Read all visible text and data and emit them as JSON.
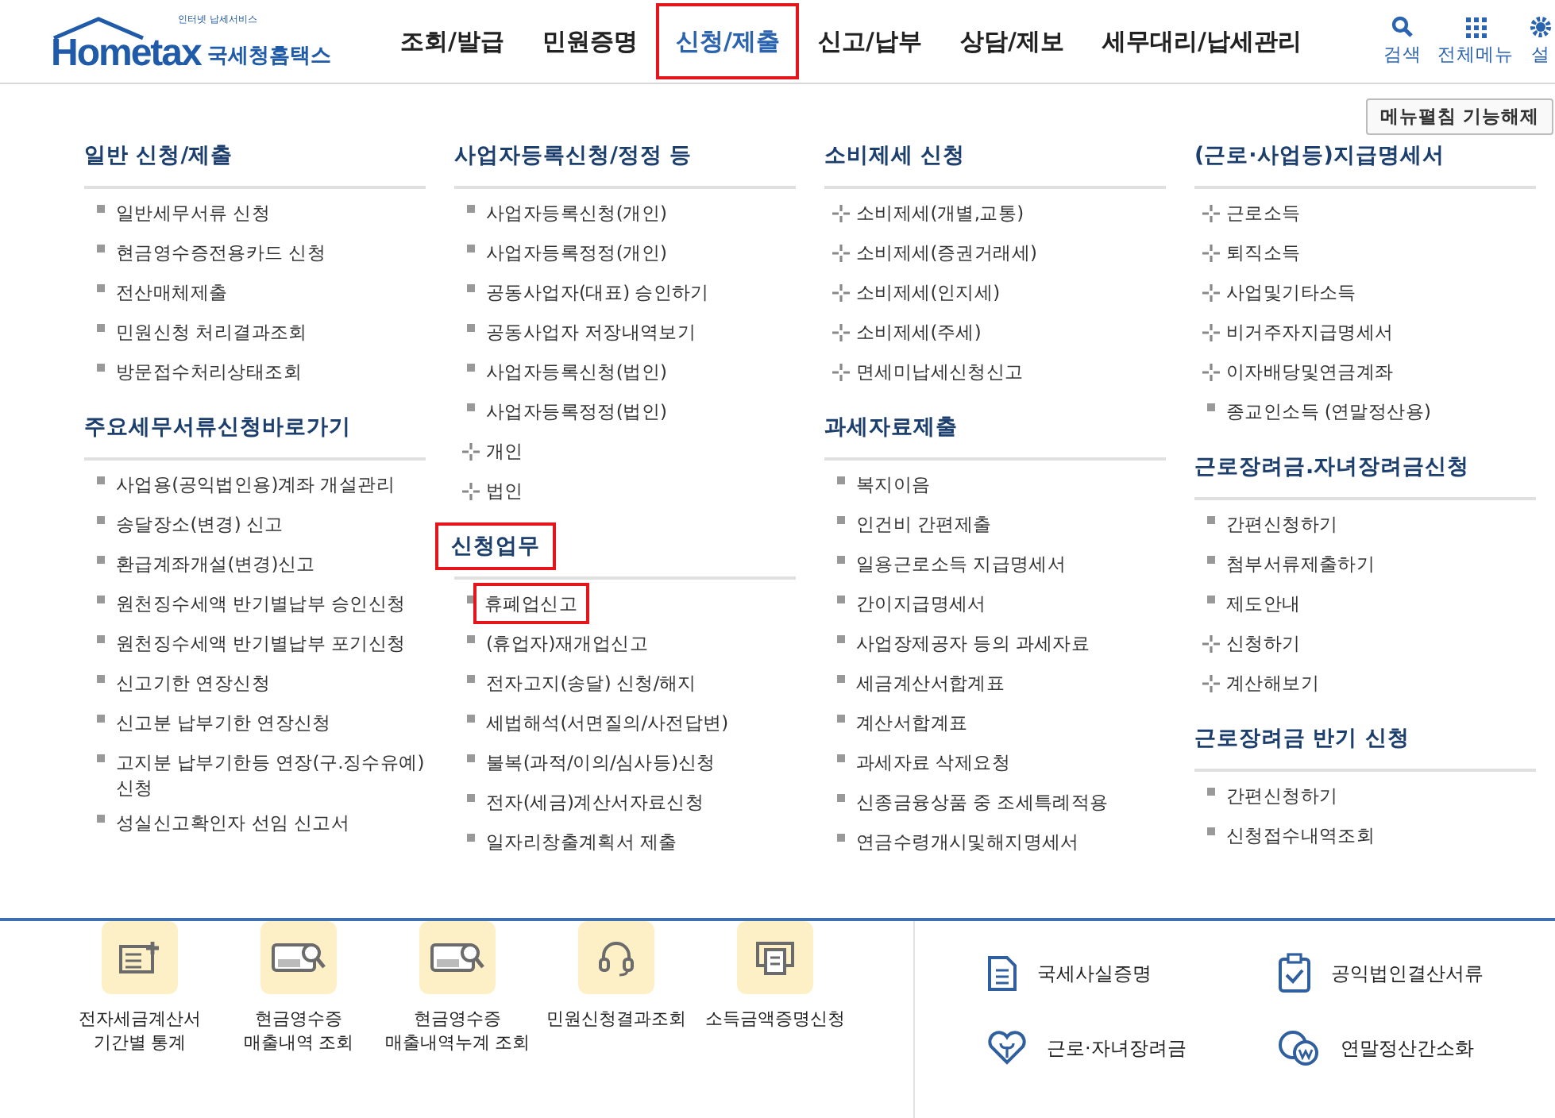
{
  "logo": {
    "tagline": "인터넷 납세서비스",
    "brand": "Hometax",
    "name": "국세청홈택스"
  },
  "nav": [
    {
      "label": "조회/발급",
      "selected": false,
      "highlighted": false
    },
    {
      "label": "민원증명",
      "selected": false,
      "highlighted": false
    },
    {
      "label": "신청/제출",
      "selected": true,
      "highlighted": true
    },
    {
      "label": "신고/납부",
      "selected": false,
      "highlighted": false
    },
    {
      "label": "상담/제보",
      "selected": false,
      "highlighted": false
    },
    {
      "label": "세무대리/납세관리",
      "selected": false,
      "highlighted": false
    }
  ],
  "utility": [
    {
      "kind": "search",
      "label": "검색"
    },
    {
      "kind": "grid",
      "label": "전체메뉴"
    },
    {
      "kind": "gear",
      "label": "설"
    }
  ],
  "menu_toggle_button": "메뉴펼침 기능해제",
  "columns": [
    [
      {
        "title": "일반 신청/제출",
        "highlighted": false,
        "items": [
          {
            "label": "일반세무서류 신청",
            "kind": "square",
            "highlighted": false
          },
          {
            "label": "현금영수증전용카드 신청",
            "kind": "square",
            "highlighted": false
          },
          {
            "label": "전산매체제출",
            "kind": "square",
            "highlighted": false
          },
          {
            "label": "민원신청 처리결과조회",
            "kind": "square",
            "highlighted": false
          },
          {
            "label": "방문접수처리상태조회",
            "kind": "square",
            "highlighted": false
          }
        ]
      },
      {
        "title": "주요세무서류신청바로가기",
        "highlighted": false,
        "items": [
          {
            "label": "사업용(공익법인용)계좌 개설관리",
            "kind": "square",
            "highlighted": false
          },
          {
            "label": "송달장소(변경) 신고",
            "kind": "square",
            "highlighted": false
          },
          {
            "label": "환급계좌개설(변경)신고",
            "kind": "square",
            "highlighted": false
          },
          {
            "label": "원천징수세액 반기별납부 승인신청",
            "kind": "square",
            "highlighted": false
          },
          {
            "label": "원천징수세액 반기별납부 포기신청",
            "kind": "square",
            "highlighted": false
          },
          {
            "label": "신고기한 연장신청",
            "kind": "square",
            "highlighted": false
          },
          {
            "label": "신고분 납부기한 연장신청",
            "kind": "square",
            "highlighted": false
          },
          {
            "label": "고지분 납부기한등 연장(구.징수유예) 신청",
            "kind": "square",
            "highlighted": false
          },
          {
            "label": "성실신고확인자 선임 신고서",
            "kind": "square",
            "highlighted": false
          }
        ]
      }
    ],
    [
      {
        "title": "사업자등록신청/정정 등",
        "highlighted": false,
        "items": [
          {
            "label": "사업자등록신청(개인)",
            "kind": "square",
            "highlighted": false
          },
          {
            "label": "사업자등록정정(개인)",
            "kind": "square",
            "highlighted": false
          },
          {
            "label": "공동사업자(대표) 승인하기",
            "kind": "square",
            "highlighted": false
          },
          {
            "label": "공동사업자 저장내역보기",
            "kind": "square",
            "highlighted": false
          },
          {
            "label": "사업자등록신청(법인)",
            "kind": "square",
            "highlighted": false
          },
          {
            "label": "사업자등록정정(법인)",
            "kind": "square",
            "highlighted": false
          },
          {
            "label": "개인",
            "kind": "plus",
            "highlighted": false
          },
          {
            "label": "법인",
            "kind": "plus",
            "highlighted": false
          }
        ]
      },
      {
        "title": "신청업무",
        "highlighted": true,
        "items": [
          {
            "label": "휴폐업신고",
            "kind": "square",
            "highlighted": true
          },
          {
            "label": "(휴업자)재개업신고",
            "kind": "square",
            "highlighted": false
          },
          {
            "label": "전자고지(송달) 신청/해지",
            "kind": "square",
            "highlighted": false
          },
          {
            "label": "세법해석(서면질의/사전답변)",
            "kind": "square",
            "highlighted": false
          },
          {
            "label": "불복(과적/이의/심사등)신청",
            "kind": "square",
            "highlighted": false
          },
          {
            "label": "전자(세금)계산서자료신청",
            "kind": "square",
            "highlighted": false
          },
          {
            "label": "일자리창출계획서 제출",
            "kind": "square",
            "highlighted": false
          }
        ]
      }
    ],
    [
      {
        "title": "소비제세 신청",
        "highlighted": false,
        "items": [
          {
            "label": "소비제세(개별,교통)",
            "kind": "plus",
            "highlighted": false
          },
          {
            "label": "소비제세(증권거래세)",
            "kind": "plus",
            "highlighted": false
          },
          {
            "label": "소비제세(인지세)",
            "kind": "plus",
            "highlighted": false
          },
          {
            "label": "소비제세(주세)",
            "kind": "plus",
            "highlighted": false
          },
          {
            "label": "면세미납세신청신고",
            "kind": "plus",
            "highlighted": false
          }
        ]
      },
      {
        "title": "과세자료제출",
        "highlighted": false,
        "items": [
          {
            "label": "복지이음",
            "kind": "square",
            "highlighted": false
          },
          {
            "label": "인건비 간편제출",
            "kind": "square",
            "highlighted": false
          },
          {
            "label": "일용근로소득 지급명세서",
            "kind": "square",
            "highlighted": false
          },
          {
            "label": "간이지급명세서",
            "kind": "square",
            "highlighted": false
          },
          {
            "label": "사업장제공자 등의 과세자료",
            "kind": "square",
            "highlighted": false
          },
          {
            "label": "세금계산서합계표",
            "kind": "square",
            "highlighted": false
          },
          {
            "label": "계산서합계표",
            "kind": "square",
            "highlighted": false
          },
          {
            "label": "과세자료 삭제요청",
            "kind": "square",
            "highlighted": false
          },
          {
            "label": "신종금융상품 중 조세특례적용",
            "kind": "square",
            "highlighted": false
          },
          {
            "label": "연금수령개시및해지명세서",
            "kind": "square",
            "highlighted": false
          }
        ]
      }
    ],
    [
      {
        "title": "(근로·사업등)지급명세서",
        "highlighted": false,
        "items": [
          {
            "label": "근로소득",
            "kind": "plus",
            "highlighted": false
          },
          {
            "label": "퇴직소득",
            "kind": "plus",
            "highlighted": false
          },
          {
            "label": "사업및기타소득",
            "kind": "plus",
            "highlighted": false
          },
          {
            "label": "비거주자지급명세서",
            "kind": "plus",
            "highlighted": false
          },
          {
            "label": "이자배당및연금계좌",
            "kind": "plus",
            "highlighted": false
          },
          {
            "label": "종교인소득 (연말정산용)",
            "kind": "square",
            "highlighted": false
          }
        ]
      },
      {
        "title": "근로장려금.자녀장려금신청",
        "highlighted": false,
        "items": [
          {
            "label": "간편신청하기",
            "kind": "square",
            "highlighted": false
          },
          {
            "label": "첨부서류제출하기",
            "kind": "square",
            "highlighted": false
          },
          {
            "label": "제도안내",
            "kind": "square",
            "highlighted": false
          },
          {
            "label": "신청하기",
            "kind": "plus",
            "highlighted": false
          },
          {
            "label": "계산해보기",
            "kind": "plus",
            "highlighted": false
          }
        ]
      },
      {
        "title": "근로장려금 반기 신청",
        "highlighted": false,
        "items": [
          {
            "label": "간편신청하기",
            "kind": "square",
            "highlighted": false
          },
          {
            "label": "신청접수내역조회",
            "kind": "square",
            "highlighted": false
          }
        ]
      }
    ]
  ],
  "quick_links": [
    {
      "kind": "invoice",
      "lines": [
        "전자세금계산서",
        "기간별 통계"
      ]
    },
    {
      "kind": "receipt",
      "lines": [
        "현금영수증",
        "매출내역 조회"
      ]
    },
    {
      "kind": "receipt",
      "lines": [
        "현금영수증",
        "매출내역누계 조회"
      ]
    },
    {
      "kind": "headset",
      "lines": [
        "민원신청결과조회"
      ]
    },
    {
      "kind": "printer",
      "lines": [
        "소득금액증명신청"
      ]
    }
  ],
  "shortcuts": [
    {
      "kind": "document",
      "label": "국세사실증명"
    },
    {
      "kind": "clipboard",
      "label": "공익법인결산서류"
    },
    {
      "kind": "heart",
      "label": "근로·자녀장려금"
    },
    {
      "kind": "coins",
      "label": "연말정산간소화"
    }
  ]
}
